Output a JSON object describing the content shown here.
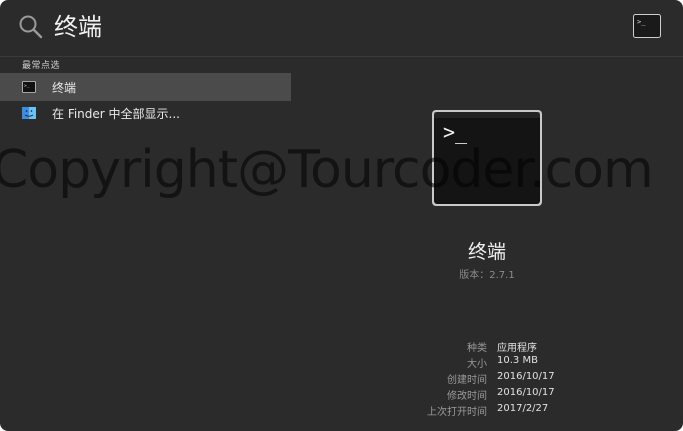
{
  "search": {
    "query": "终端"
  },
  "results": {
    "section_title": "最常点选",
    "items": [
      {
        "label": "终端",
        "icon": "terminal-icon"
      },
      {
        "label": "在 Finder 中全部显示...",
        "icon": "finder-icon"
      }
    ]
  },
  "preview": {
    "icon_glyph": ">_",
    "app_name": "终端",
    "version": "版本：2.7.1",
    "meta": [
      {
        "key": "种类",
        "value": "应用程序"
      },
      {
        "key": "大小",
        "value": "10.3 MB"
      },
      {
        "key": "创建时间",
        "value": "2016/10/17"
      },
      {
        "key": "修改时间",
        "value": "2016/10/17"
      },
      {
        "key": "上次打开时间",
        "value": "2017/2/27"
      }
    ]
  },
  "watermark": "Copyright@Tourcoder.com",
  "colors": {
    "window_bg": "#2b2b2b",
    "selected_row": "#4b4b4b"
  }
}
